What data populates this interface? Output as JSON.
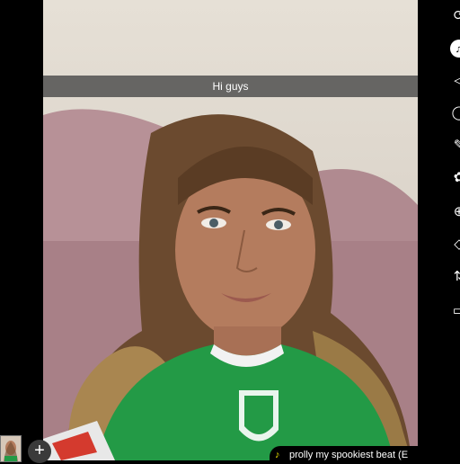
{
  "caption": {
    "text": "Hi guys"
  },
  "sound": {
    "label": "prolly my spookiest beat (E",
    "icon": "music-icon"
  },
  "toolbar": {
    "tools": [
      {
        "icon": "flip-camera-icon",
        "glyph": "⟳"
      },
      {
        "icon": "music-note-icon",
        "glyph": "♫"
      },
      {
        "icon": "speaker-icon",
        "glyph": "◁"
      },
      {
        "icon": "timer-icon",
        "glyph": "◯"
      },
      {
        "icon": "effects-icon",
        "glyph": "✎"
      },
      {
        "icon": "filters-icon",
        "glyph": "✿"
      },
      {
        "icon": "microphone-icon",
        "glyph": "⊕"
      },
      {
        "icon": "eraser-icon",
        "glyph": "◇"
      },
      {
        "icon": "crop-icon",
        "glyph": "⇅"
      },
      {
        "icon": "captions-icon",
        "glyph": "▭"
      }
    ]
  },
  "bottom": {
    "add_glyph": "+"
  }
}
